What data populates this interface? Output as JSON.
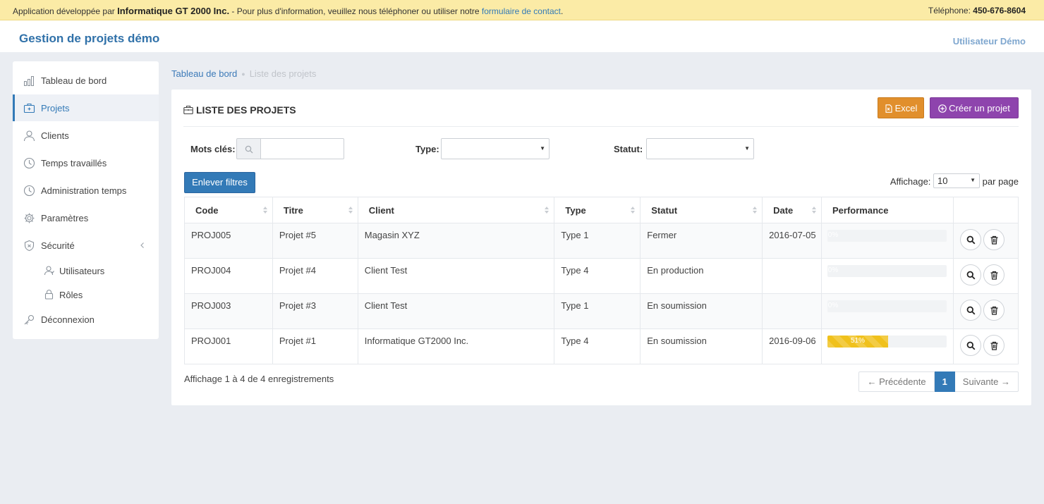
{
  "topbar": {
    "dev_prefix": "Application développée par",
    "company": "Informatique GT 2000 Inc.",
    "info_text": "- Pour plus d'information, veuillez nous téléphoner ou utiliser notre",
    "contact_link": "formulaire de contact",
    "period": ".",
    "phone_label": "Téléphone:",
    "phone_number": "450-676-8604"
  },
  "header": {
    "app_title": "Gestion de projets démo",
    "user": "Utilisateur Démo"
  },
  "sidebar": {
    "items": [
      {
        "label": "Tableau de bord",
        "icon": "bar-chart-icon"
      },
      {
        "label": "Projets",
        "icon": "briefcase-icon",
        "active": true
      },
      {
        "label": "Clients",
        "icon": "user-icon"
      },
      {
        "label": "Temps travaillés",
        "icon": "clock-icon"
      },
      {
        "label": "Administration temps",
        "icon": "clock-icon"
      },
      {
        "label": "Paramètres",
        "icon": "gear-icon"
      },
      {
        "label": "Sécurité",
        "icon": "shield-icon"
      },
      {
        "label": "Déconnexion",
        "icon": "key-icon"
      }
    ],
    "sub_items": [
      {
        "label": "Utilisateurs",
        "icon": "users-icon"
      },
      {
        "label": "Rôles",
        "icon": "lock-icon"
      }
    ]
  },
  "breadcrumb": {
    "home": "Tableau de bord",
    "current": "Liste des projets"
  },
  "panel": {
    "title": "LISTE DES PROJETS",
    "excel_label": "Excel",
    "create_label": "Créer un projet"
  },
  "filters": {
    "keywords_label": "Mots clés:",
    "keywords_value": "",
    "type_label": "Type:",
    "type_value": "",
    "status_label": "Statut:",
    "status_value": "",
    "clear_label": "Enlever filtres"
  },
  "length": {
    "label": "Affichage:",
    "value": "10",
    "suffix": "par page"
  },
  "table": {
    "columns": [
      "Code",
      "Titre",
      "Client",
      "Type",
      "Statut",
      "Date",
      "Performance"
    ],
    "rows": [
      {
        "code": "PROJ005",
        "title": "Projet #5",
        "client": "Magasin XYZ",
        "type": "Type 1",
        "status": "Fermer",
        "date": "2016-07-05",
        "perf": 0,
        "perf_label": "0%"
      },
      {
        "code": "PROJ004",
        "title": "Projet #4",
        "client": "Client Test",
        "type": "Type 4",
        "status": "En production",
        "date": "",
        "perf": 0,
        "perf_label": "0%"
      },
      {
        "code": "PROJ003",
        "title": "Projet #3",
        "client": "Client Test",
        "type": "Type 1",
        "status": "En soumission",
        "date": "",
        "perf": 0,
        "perf_label": "0%"
      },
      {
        "code": "PROJ001",
        "title": "Projet #1",
        "client": "Informatique GT2000 Inc.",
        "type": "Type 4",
        "status": "En soumission",
        "date": "2016-09-06",
        "perf": 51,
        "perf_label": "51%"
      }
    ]
  },
  "footer": {
    "info": "Affichage 1 à 4 de 4 enregistrements",
    "prev": "← Précédente",
    "page": "1",
    "next": "Suivante →"
  },
  "colors": {
    "primary": "#337ab7",
    "excel": "#e18f2c",
    "create": "#8e44ad",
    "progress": "#f0c11c",
    "topbar": "#fbeba6"
  }
}
